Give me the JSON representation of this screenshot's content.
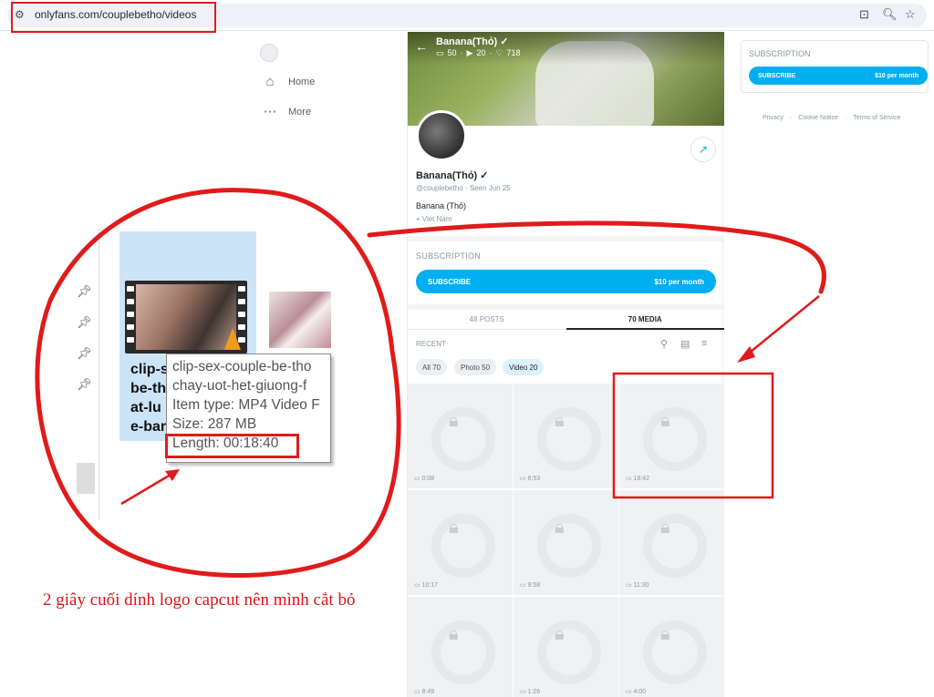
{
  "browser": {
    "url": "onlyfans.com/couplebetho/videos",
    "icons": [
      "site-settings-icon",
      "install-app-icon",
      "zoom-icon",
      "bookmark-star-icon"
    ]
  },
  "sidebar": {
    "items": [
      {
        "label": "Home",
        "icon": "home-icon"
      },
      {
        "label": "More",
        "icon": "more-icon"
      }
    ]
  },
  "profile": {
    "cover_name": "Banana(Thỏ)",
    "stats": {
      "posts": "50",
      "media": "20",
      "likes": "718"
    },
    "name": "Banana(Thỏ)",
    "handle": "@couplebetho",
    "seen": "Seen  Jun 25",
    "display_name": "Banana (Thỏ)",
    "location": "Viet Nam",
    "subscription": {
      "title": "SUBSCRIPTION",
      "button_label": "SUBSCRIBE",
      "price": "$10 per month"
    },
    "tabs": [
      {
        "label": "48 POSTS",
        "active": false
      },
      {
        "label": "70 MEDIA",
        "active": true
      }
    ],
    "recent_label": "RECENT",
    "filters": [
      {
        "label": "All 70",
        "active": false
      },
      {
        "label": "Photo 50",
        "active": false
      },
      {
        "label": "Video 20",
        "active": true
      }
    ],
    "media": [
      {
        "duration": "0:08"
      },
      {
        "duration": "8:53"
      },
      {
        "duration": "18:42"
      },
      {
        "duration": "10:17"
      },
      {
        "duration": "9:58"
      },
      {
        "duration": "11:30"
      },
      {
        "duration": "8:49"
      },
      {
        "duration": "1:26"
      },
      {
        "duration": "4:00"
      }
    ]
  },
  "right_panel": {
    "subscription_title": "SUBSCRIPTION",
    "button_label": "SUBSCRIBE",
    "price": "$10 per month",
    "footer": [
      "Privacy",
      "Cookie Notice",
      "Terms of Service"
    ]
  },
  "explorer": {
    "tile_lines": [
      "clip-s",
      "be-th",
      "at-lu",
      "e-bar"
    ],
    "tooltip_lines": [
      "clip-sex-couple-be-tho",
      "chay-uot-het-giuong-f",
      "Item type: MP4 Video F",
      "Size: 287 MB",
      "Length: 00:18:40"
    ]
  },
  "annotation": {
    "caption": "2 giây cuối dính logo capcut nên mình cắt bỏ",
    "color": "#e01b1b"
  },
  "colors": {
    "accent": "#00aff0",
    "annotation_red": "#e01b1b"
  }
}
